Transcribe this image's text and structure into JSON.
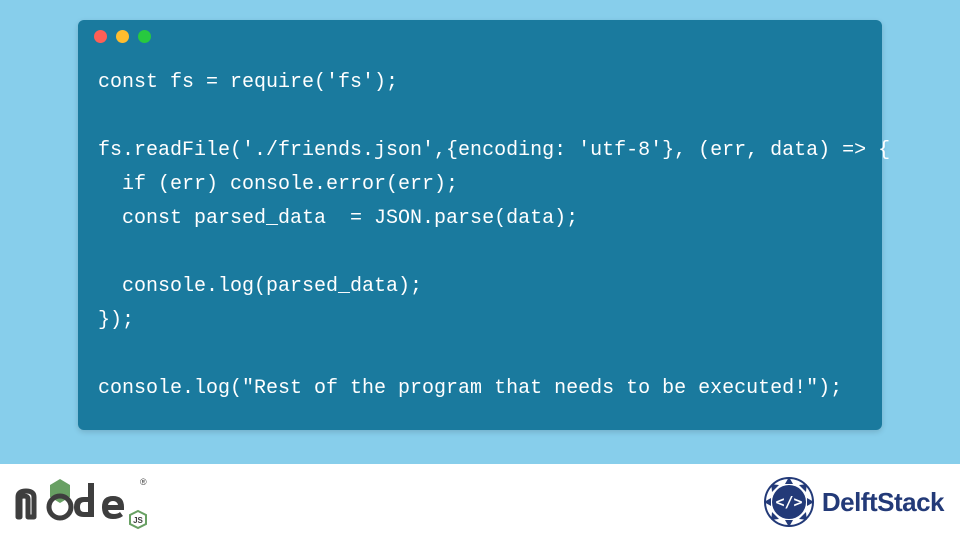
{
  "traffic_lights": {
    "red": "#ff5f56",
    "yellow": "#ffbd2e",
    "green": "#27c93f"
  },
  "code": {
    "lines": [
      "const fs = require('fs');",
      "",
      "fs.readFile('./friends.json',{encoding: 'utf-8'}, (err, data) => {",
      "  if (err) console.error(err);",
      "  const parsed_data  = JSON.parse(data);",
      "",
      "  console.log(parsed_data);",
      "});",
      "",
      "console.log(\"Rest of the program that needs to be executed!\");"
    ]
  },
  "footer": {
    "left_logo": "node",
    "right_brand": "DelftStack"
  },
  "colors": {
    "page_bg": "#87ceeb",
    "window_bg": "#1a7a9e",
    "code_text": "#ffffff",
    "footer_bg": "#ffffff",
    "brand_accent": "#233a78"
  }
}
